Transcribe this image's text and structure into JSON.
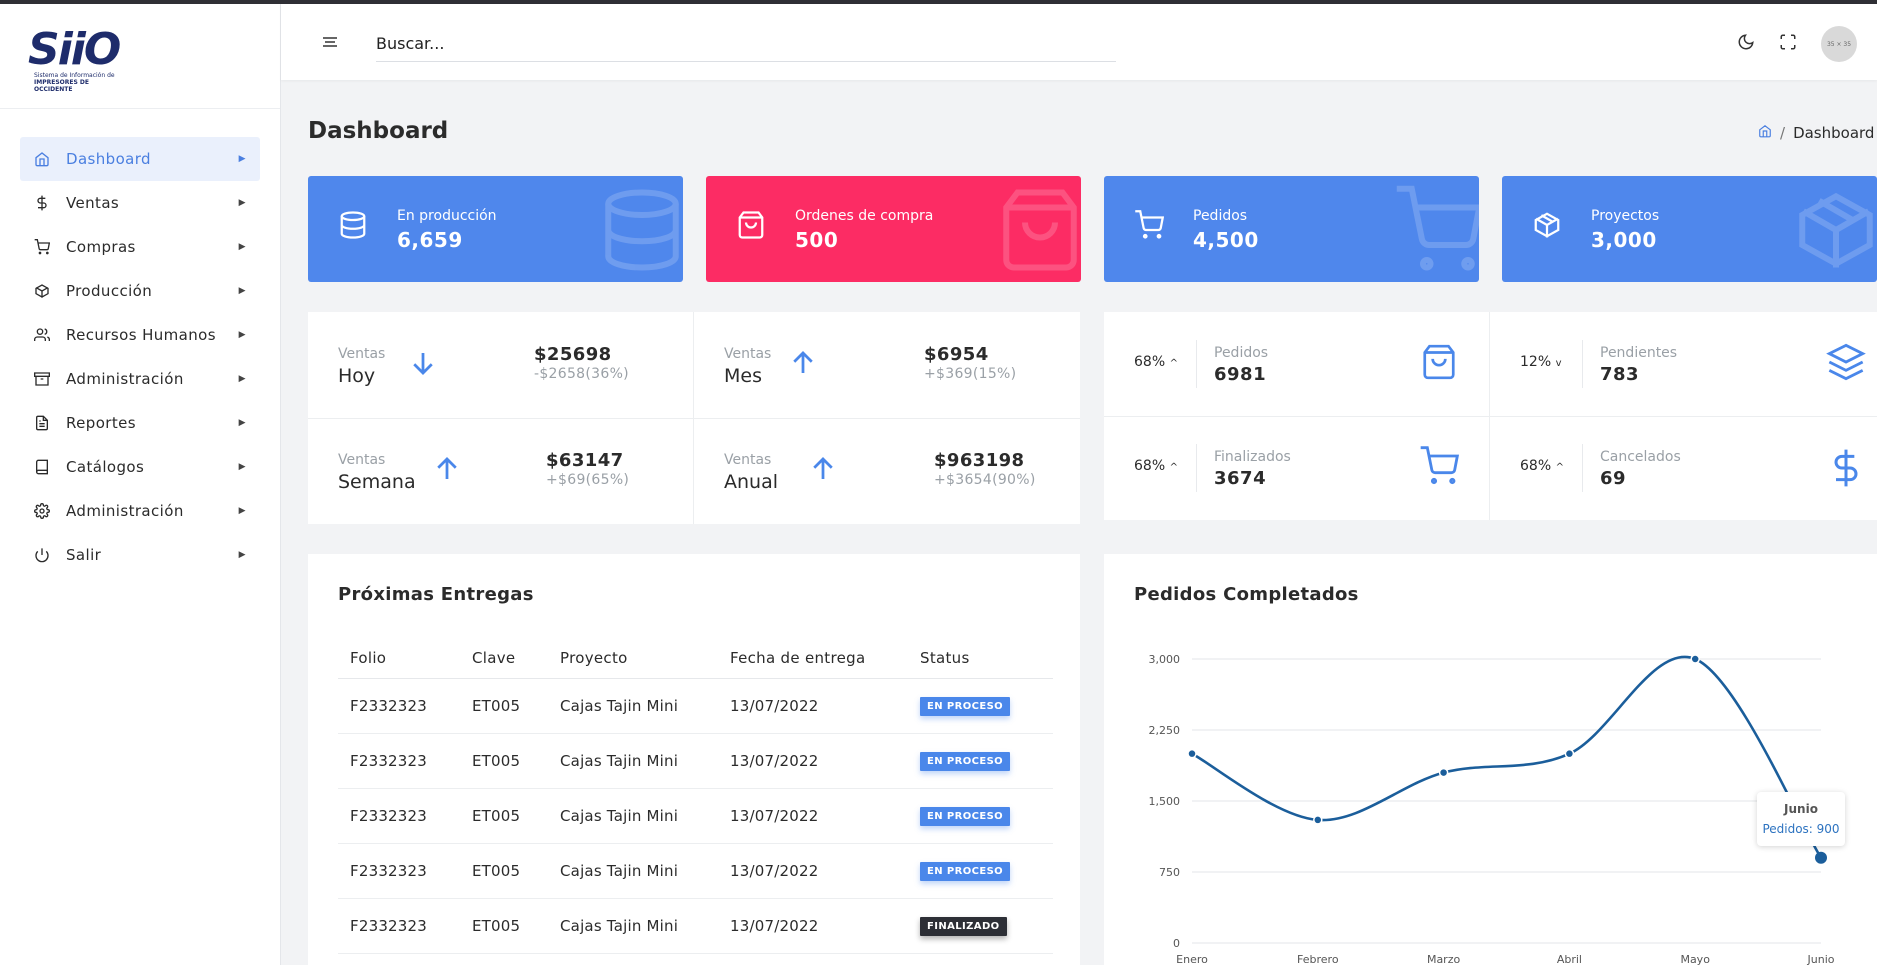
{
  "app": {
    "logo_text": "SiiO",
    "logo_sub1": "Sistema de Información de",
    "logo_sub2": "IMPRESORES DE OCCIDENTE"
  },
  "sidebar": {
    "items": [
      {
        "label": "Dashboard",
        "icon": "home-icon",
        "active": true
      },
      {
        "label": "Ventas",
        "icon": "dollar-icon"
      },
      {
        "label": "Compras",
        "icon": "cart-icon"
      },
      {
        "label": "Producción",
        "icon": "box-icon"
      },
      {
        "label": "Recursos Humanos",
        "icon": "users-icon"
      },
      {
        "label": "Administración",
        "icon": "archive-icon"
      },
      {
        "label": "Reportes",
        "icon": "file-icon"
      },
      {
        "label": "Catálogos",
        "icon": "book-icon"
      },
      {
        "label": "Administración",
        "icon": "gear-icon"
      },
      {
        "label": "Salir",
        "icon": "power-icon"
      }
    ]
  },
  "header": {
    "search_text": "Buscar...",
    "avatar_text": "35 × 35"
  },
  "page": {
    "title": "Dashboard",
    "breadcrumb": "Dashboard"
  },
  "stats": [
    {
      "label": "En producción",
      "value": "6,659",
      "color": "#4f87ec",
      "icon": "database-icon"
    },
    {
      "label": "Ordenes de compra",
      "value": "500",
      "color": "#fc2c64",
      "icon": "shopping-bag-icon"
    },
    {
      "label": "Pedidos",
      "value": "4,500",
      "color": "#4f87ec",
      "icon": "cart-icon"
    },
    {
      "label": "Proyectos",
      "value": "3,000",
      "color": "#4f87ec",
      "icon": "package-icon"
    }
  ],
  "sales": [
    {
      "label": "Ventas",
      "period": "Hoy",
      "direction": "down",
      "amount": "$25698",
      "diff": "-$2658(36%)"
    },
    {
      "label": "Ventas",
      "period": "Mes",
      "direction": "up",
      "amount": "$6954",
      "diff": "+$369(15%)"
    },
    {
      "label": "Ventas",
      "period": "Semana",
      "direction": "up",
      "amount": "$63147",
      "diff": "+$69(65%)"
    },
    {
      "label": "Ventas",
      "period": "Anual",
      "direction": "up",
      "amount": "$963198",
      "diff": "+$3654(90%)"
    }
  ],
  "kpis": [
    {
      "pct": "68%",
      "trend": "up",
      "label": "Pedidos",
      "value": "6981",
      "icon": "shopping-bag-icon"
    },
    {
      "pct": "12%",
      "trend": "down",
      "label": "Pendientes",
      "value": "783",
      "icon": "layers-icon"
    },
    {
      "pct": "68%",
      "trend": "up",
      "label": "Finalizados",
      "value": "3674",
      "icon": "cart-icon"
    },
    {
      "pct": "68%",
      "trend": "up",
      "label": "Cancelados",
      "value": "69",
      "icon": "dollar-icon"
    }
  ],
  "deliveries": {
    "title": "Próximas Entregas",
    "columns": [
      "Folio",
      "Clave",
      "Proyecto",
      "Fecha de entrega",
      "Status"
    ],
    "rows": [
      {
        "folio": "F2332323",
        "clave": "ET005",
        "proyecto": "Cajas Tajin Mini",
        "fecha": "13/07/2022",
        "status": "EN PROCESO"
      },
      {
        "folio": "F2332323",
        "clave": "ET005",
        "proyecto": "Cajas Tajin Mini",
        "fecha": "13/07/2022",
        "status": "EN PROCESO"
      },
      {
        "folio": "F2332323",
        "clave": "ET005",
        "proyecto": "Cajas Tajin Mini",
        "fecha": "13/07/2022",
        "status": "EN PROCESO"
      },
      {
        "folio": "F2332323",
        "clave": "ET005",
        "proyecto": "Cajas Tajin Mini",
        "fecha": "13/07/2022",
        "status": "EN PROCESO"
      },
      {
        "folio": "F2332323",
        "clave": "ET005",
        "proyecto": "Cajas Tajin Mini",
        "fecha": "13/07/2022",
        "status": "FINALIZADO"
      }
    ]
  },
  "chart_data": {
    "type": "line",
    "title": "Pedidos Completados",
    "categories": [
      "Enero",
      "Febrero",
      "Marzo",
      "Abril",
      "Mayo",
      "Junio"
    ],
    "series": [
      {
        "name": "Pedidos",
        "values": [
          2000,
          1300,
          1800,
          2000,
          3000,
          900
        ]
      }
    ],
    "ylim": [
      0,
      3000
    ],
    "yticks": [
      "0",
      "750",
      "1,500",
      "2,250",
      "3,000"
    ],
    "grid": true,
    "line_color": "#1b5e9b",
    "tooltip": {
      "title": "Junio",
      "text": "Pedidos: 900"
    }
  }
}
